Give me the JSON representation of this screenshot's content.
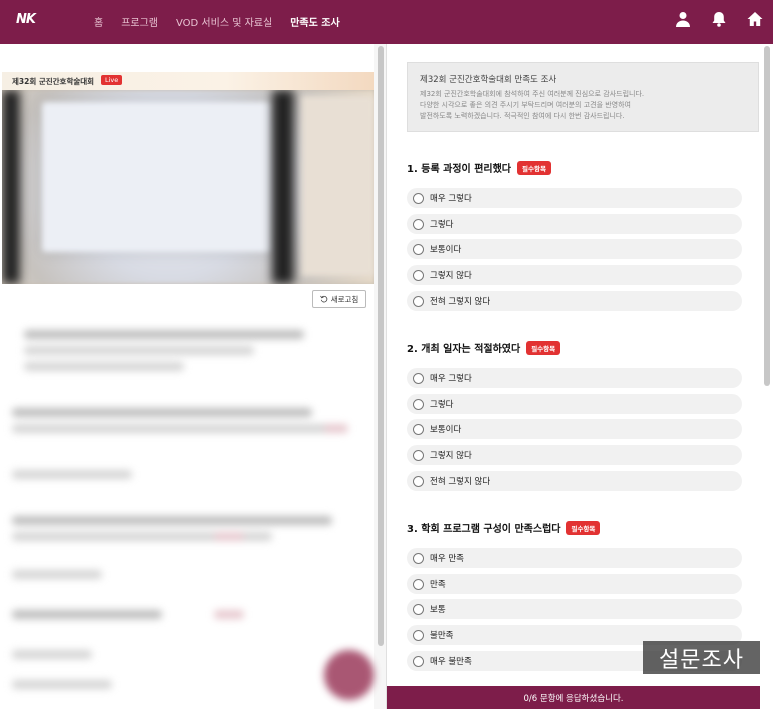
{
  "header": {
    "logo_text": "NK",
    "nav": [
      {
        "label": "홈",
        "active": false
      },
      {
        "label": "프로그램",
        "active": false
      },
      {
        "label": "VOD 서비스 및 자료실",
        "active": false
      },
      {
        "label": "만족도 조사",
        "active": true
      }
    ],
    "icons": [
      "user-icon",
      "bell-icon",
      "home-icon"
    ],
    "bg_color": "#7d1d4a"
  },
  "video": {
    "title": "제32회 군진간호학술대회",
    "live_label": "Live"
  },
  "refresh_label": "새로고침",
  "survey": {
    "intro_title": "제32회 군진간호학술대회 만족도 조사",
    "intro_lines": [
      "제32회 군진간호학술대회에 참석하여 주신 여러분께 진심으로 감사드립니다.",
      "다양한 시각으로 좋은 의견 주시기 부탁드리며 여러분의 고견을 반영하여",
      "발전하도록 노력하겠습니다. 적극적인 참여에 다시 한번 감사드립니다."
    ],
    "required_label": "필수항목",
    "questions": [
      {
        "title": "1. 등록 과정이 편리했다",
        "options": [
          "매우 그렇다",
          "그렇다",
          "보통이다",
          "그렇지 않다",
          "전혀 그렇지 않다"
        ]
      },
      {
        "title": "2. 개최 일자는 적절하였다",
        "options": [
          "매우 그렇다",
          "그렇다",
          "보통이다",
          "그렇지 않다",
          "전혀 그렇지 않다"
        ]
      },
      {
        "title": "3. 학회 프로그램 구성이 만족스럽다",
        "options": [
          "매우 만족",
          "만족",
          "보통",
          "불만족",
          "매우 불만족"
        ]
      }
    ],
    "progress_text": "0/6 문항에 응답하셨습니다.",
    "answered": 0,
    "total": 6
  },
  "watermark": "설문조사",
  "colors": {
    "accent": "#7d1d4a",
    "required": "#e23232"
  }
}
